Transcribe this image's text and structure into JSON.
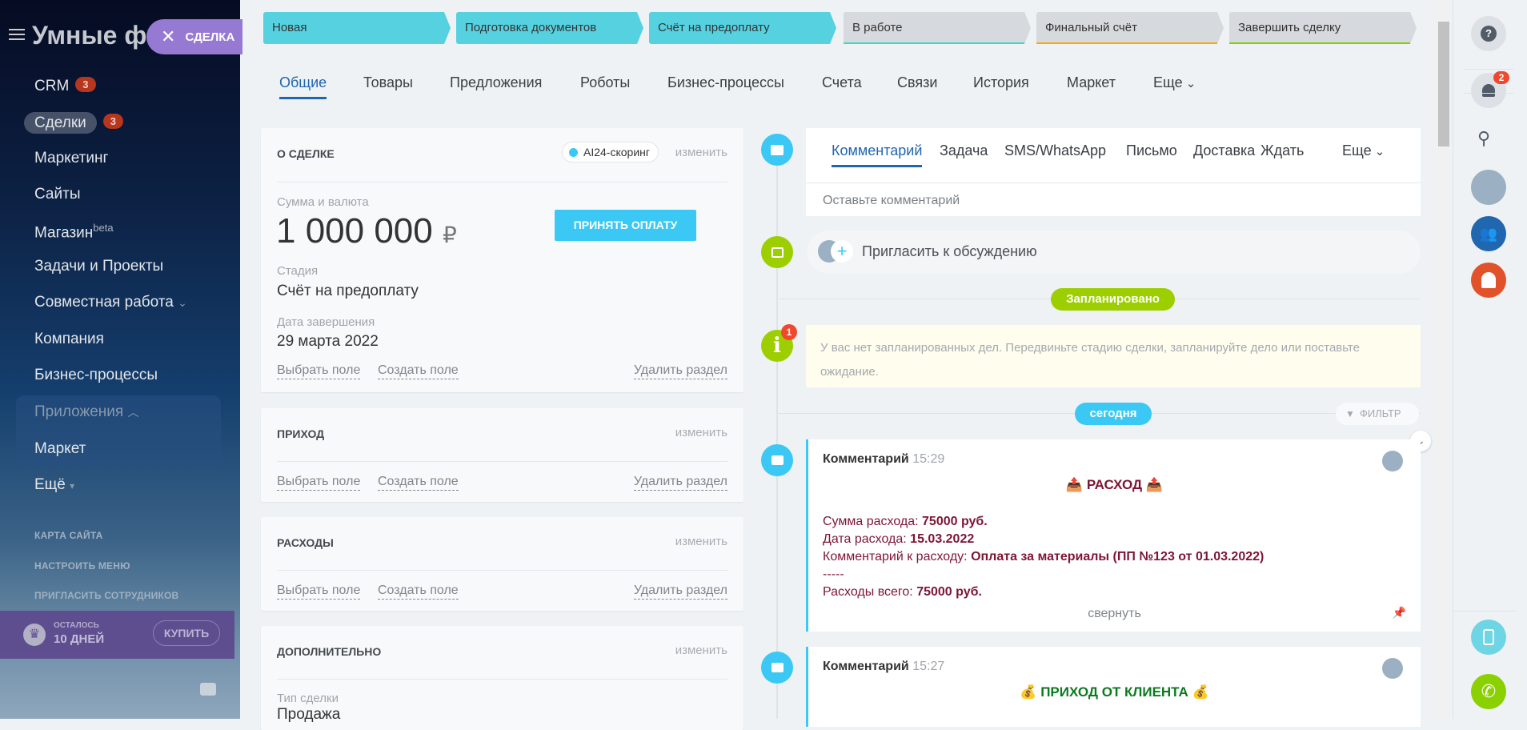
{
  "sidebar": {
    "logo": "Умные фи",
    "items": [
      {
        "label": "CRM",
        "badge": "3"
      },
      {
        "label": "Сделки",
        "badge": "3"
      },
      {
        "label": "Маркетинг"
      },
      {
        "label": "Сайты"
      },
      {
        "label": "Магазин",
        "sup": "beta"
      },
      {
        "label": "Задачи и Проекты"
      },
      {
        "label": "Совместная работа"
      },
      {
        "label": "Компания"
      },
      {
        "label": "Бизнес-процессы"
      },
      {
        "label": "Приложения"
      },
      {
        "label": "Маркет"
      },
      {
        "label": "Ещё"
      }
    ],
    "links": [
      "КАРТА САЙТА",
      "НАСТРОИТЬ МЕНЮ",
      "ПРИГЛАСИТЬ СОТРУДНИКОВ"
    ],
    "trial": {
      "line1": "ОСТАЛОСЬ",
      "line2": "10 ДНЕЙ",
      "buy": "КУПИТЬ"
    }
  },
  "deal_pill": "СДЕЛКА",
  "stages": [
    {
      "label": "Новая",
      "state": "done"
    },
    {
      "label": "Подготовка документов",
      "state": "done"
    },
    {
      "label": "Счёт на предоплату",
      "state": "done"
    },
    {
      "label": "В работе",
      "state": "todo",
      "color": "#3ed9c0"
    },
    {
      "label": "Финальный счёт",
      "state": "todo",
      "color": "#ffa800"
    },
    {
      "label": "Завершить сделку",
      "state": "todo",
      "color": "#7bd500"
    }
  ],
  "tabs": [
    "Общие",
    "Товары",
    "Предложения",
    "Роботы",
    "Бизнес-процессы",
    "Счета",
    "Связи",
    "История",
    "Маркет",
    "Еще"
  ],
  "about": {
    "title": "О СДЕЛКЕ",
    "scoring": "AI24-скоринг",
    "edit": "изменить",
    "amount_label": "Сумма и валюта",
    "amount": "1 000 000",
    "currency": "₽",
    "pay_button": "ПРИНЯТЬ ОПЛАТУ",
    "stage_label": "Стадия",
    "stage_value": "Счёт на предоплату",
    "date_label": "Дата завершения",
    "date_value": "29 марта 2022"
  },
  "field_links": {
    "choose": "Выбрать поле",
    "create": "Создать поле",
    "delete": "Удалить раздел"
  },
  "income": {
    "title": "ПРИХОД",
    "edit": "изменить"
  },
  "expenses": {
    "title": "РАСХОДЫ",
    "edit": "изменить"
  },
  "extra": {
    "title": "ДОПОЛНИТЕЛЬНО",
    "edit": "изменить",
    "type_label": "Тип сделки",
    "type_value": "Продажа"
  },
  "composer": {
    "tabs": [
      "Комментарий",
      "Задача",
      "SMS/WhatsApp",
      "Письмо",
      "Доставка",
      "Ждать",
      "Еще"
    ],
    "placeholder": "Оставьте комментарий"
  },
  "invite": "Пригласить к обсуждению",
  "planned": {
    "badge": "Запланировано",
    "notice": "У вас нет запланированных дел. Передвиньте стадию сделки, запланируйте дело или поставьте ожидание.",
    "count": "1"
  },
  "today": "сегодня",
  "filter": "ФИЛЬТР",
  "comments": [
    {
      "title": "Комментарий",
      "time": "15:29",
      "heading": "РАСХОД",
      "lines": [
        {
          "label": "Сумма расхода: ",
          "value": "75000 руб."
        },
        {
          "label": "Дата расхода: ",
          "value": "15.03.2022"
        },
        {
          "label": "Комментарий к расходу: ",
          "value": "Оплата за материалы (ПП №123 от 01.03.2022)"
        }
      ],
      "divider": "-----",
      "total": {
        "label": "Расходы всего: ",
        "value": "75000 руб."
      },
      "collapse": "свернуть"
    },
    {
      "title": "Комментарий",
      "time": "15:27",
      "heading": "ПРИХОД ОТ КЛИЕНТА"
    }
  ],
  "right_sidebar": {
    "notifications": "2"
  },
  "colors": {
    "accent": "#2066b0",
    "stage_done": "#56d1e0",
    "green": "#9dcf00",
    "blue": "#3bc8f5"
  }
}
